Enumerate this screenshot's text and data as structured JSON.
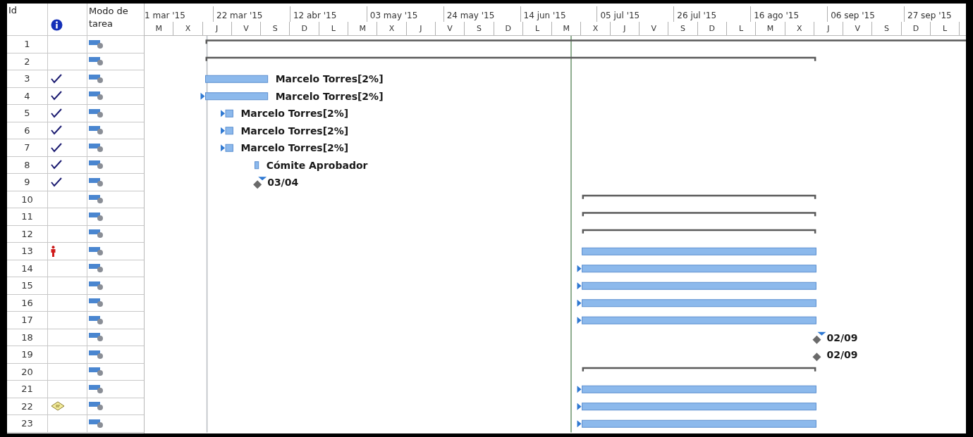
{
  "columns": {
    "number": "Id",
    "mode": "Modo de tarea"
  },
  "timescale": {
    "upper": [
      "1 mar '15",
      "22 mar '15",
      "12 abr '15",
      "03 may '15",
      "24 may '15",
      "14 jun '15",
      "05 jul '15",
      "26 jul '15",
      "16 ago '15",
      "06 sep '15",
      "27 sep '15"
    ],
    "lower": [
      "M",
      "X",
      "J",
      "V",
      "S",
      "D",
      "L",
      "M",
      "X",
      "J",
      "V",
      "S",
      "D",
      "L",
      "M",
      "X",
      "J",
      "V",
      "S",
      "D",
      "L",
      "M",
      "X",
      "J",
      "V",
      "S",
      "D",
      "L"
    ]
  },
  "rows": [
    {
      "number": "1",
      "completed": false,
      "overallocated": false,
      "has_note": false,
      "bar": {
        "kind": "summary"
      }
    },
    {
      "number": "2",
      "completed": false,
      "overallocated": false,
      "has_note": false,
      "bar": {
        "kind": "summary"
      }
    },
    {
      "number": "3",
      "completed": true,
      "overallocated": false,
      "has_note": false,
      "bar": {
        "kind": "task",
        "label": "Marcelo Torres[2%]",
        "linked": false
      }
    },
    {
      "number": "4",
      "completed": true,
      "overallocated": false,
      "has_note": false,
      "bar": {
        "kind": "task",
        "label": "Marcelo Torres[2%]",
        "linked": true
      }
    },
    {
      "number": "5",
      "completed": true,
      "overallocated": false,
      "has_note": false,
      "bar": {
        "kind": "task",
        "label": "Marcelo Torres[2%]",
        "linked": true
      }
    },
    {
      "number": "6",
      "completed": true,
      "overallocated": false,
      "has_note": false,
      "bar": {
        "kind": "task",
        "label": "Marcelo Torres[2%]",
        "linked": true
      }
    },
    {
      "number": "7",
      "completed": true,
      "overallocated": false,
      "has_note": false,
      "bar": {
        "kind": "task",
        "label": "Marcelo Torres[2%]",
        "linked": true
      }
    },
    {
      "number": "8",
      "completed": true,
      "overallocated": false,
      "has_note": false,
      "bar": {
        "kind": "task",
        "label": "Cómite Aprobador",
        "linked": false
      }
    },
    {
      "number": "9",
      "completed": true,
      "overallocated": false,
      "has_note": false,
      "bar": {
        "kind": "milestone",
        "label": "03/04",
        "linked": true
      }
    },
    {
      "number": "10",
      "completed": false,
      "overallocated": false,
      "has_note": false,
      "bar": {
        "kind": "summary"
      }
    },
    {
      "number": "11",
      "completed": false,
      "overallocated": false,
      "has_note": false,
      "bar": {
        "kind": "summary"
      }
    },
    {
      "number": "12",
      "completed": false,
      "overallocated": false,
      "has_note": false,
      "bar": {
        "kind": "summary"
      }
    },
    {
      "number": "13",
      "completed": false,
      "overallocated": true,
      "has_note": false,
      "bar": {
        "kind": "task",
        "linked": false
      }
    },
    {
      "number": "14",
      "completed": false,
      "overallocated": false,
      "has_note": false,
      "bar": {
        "kind": "task",
        "linked": true
      }
    },
    {
      "number": "15",
      "completed": false,
      "overallocated": false,
      "has_note": false,
      "bar": {
        "kind": "task",
        "linked": true
      }
    },
    {
      "number": "16",
      "completed": false,
      "overallocated": false,
      "has_note": false,
      "bar": {
        "kind": "task",
        "linked": true
      }
    },
    {
      "number": "17",
      "completed": false,
      "overallocated": false,
      "has_note": false,
      "bar": {
        "kind": "task",
        "linked": true
      }
    },
    {
      "number": "18",
      "completed": false,
      "overallocated": false,
      "has_note": false,
      "bar": {
        "kind": "milestone",
        "label": "02/09",
        "linked": true
      }
    },
    {
      "number": "19",
      "completed": false,
      "overallocated": false,
      "has_note": false,
      "bar": {
        "kind": "milestone",
        "label": "02/09",
        "linked": false
      }
    },
    {
      "number": "20",
      "completed": false,
      "overallocated": false,
      "has_note": false,
      "bar": {
        "kind": "summary"
      }
    },
    {
      "number": "21",
      "completed": false,
      "overallocated": false,
      "has_note": false,
      "bar": {
        "kind": "task",
        "linked": true
      }
    },
    {
      "number": "22",
      "completed": false,
      "overallocated": false,
      "has_note": true,
      "bar": {
        "kind": "task",
        "linked": true
      }
    },
    {
      "number": "23",
      "completed": false,
      "overallocated": false,
      "has_note": false,
      "bar": {
        "kind": "task",
        "linked": true
      }
    }
  ]
}
